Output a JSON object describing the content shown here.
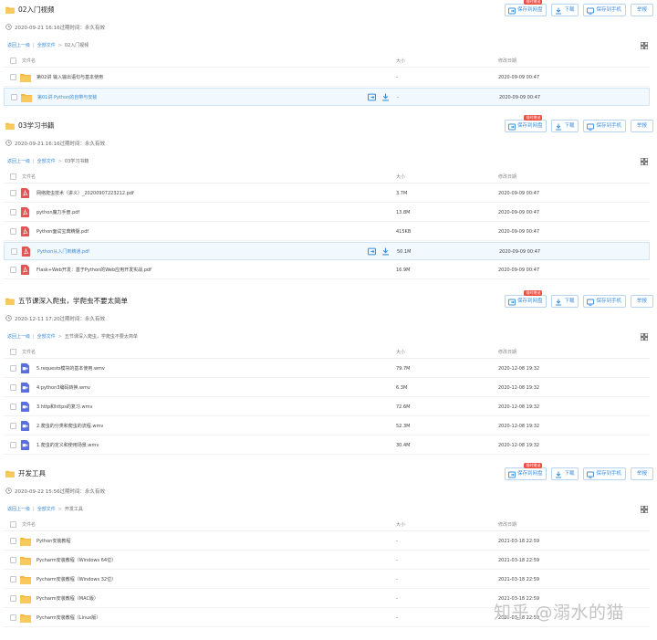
{
  "colors": {
    "accent": "#3b8cd9",
    "folder": "#f5b942",
    "pdf": "#e05555",
    "video": "#5b6ee1",
    "badge": "#e74c3c"
  },
  "icons": {
    "folder": "folder-icon",
    "pdf": "pdf-file-icon",
    "video": "video-file-icon",
    "clock": "clock-icon",
    "grid": "grid-view-icon",
    "save": "save-to-netdisk-icon",
    "download": "download-icon",
    "phone": "save-to-phone-icon"
  },
  "buttons": {
    "save_label": "保存到网盘",
    "download_label": "下载",
    "phone_label": "保存到手机",
    "report_label": "举报",
    "badge_label": "限时赠送"
  },
  "table_headers": {
    "name": "文件名",
    "size": "大小",
    "date": "修改日期"
  },
  "crumb": {
    "back": "返回上一级",
    "all": "全部文件"
  },
  "sections": [
    {
      "title": "02入门视频",
      "meta": "2020-09-21 16:16过期时间：永久有效",
      "crumb_current": "02入门视频",
      "rows": [
        {
          "name": "第02讲 输入输出语句与基本使用",
          "size": "-",
          "date": "2020-09-09 00:47",
          "type": "folder"
        },
        {
          "name": "第01讲 Python的自带与安装",
          "size": "-",
          "date": "2020-09-09 00:47",
          "type": "folder",
          "selected": true
        }
      ]
    },
    {
      "title": "03学习书籍",
      "meta": "2020-09-21 16:16过期时间：永久有效",
      "crumb_current": "03学习书籍",
      "rows": [
        {
          "name": "网络爬虫技术（讲义）_20200907223212.pdf",
          "size": "3.7M",
          "date": "2020-09-09 00:47",
          "type": "pdf"
        },
        {
          "name": "python魔力手册.pdf",
          "size": "13.8M",
          "date": "2020-09-09 00:47",
          "type": "pdf"
        },
        {
          "name": "Python面试宝典精髓.pdf",
          "size": "415KB",
          "date": "2020-09-09 00:47",
          "type": "pdf"
        },
        {
          "name": "Python从入门到精通.pdf",
          "size": "50.1M",
          "date": "2020-09-09 00:47",
          "type": "pdf",
          "selected": true
        },
        {
          "name": "Flask+Web开发：基于Python的Web应用开发实战.pdf",
          "size": "16.9M",
          "date": "2020-09-09 00:47",
          "type": "pdf"
        }
      ]
    },
    {
      "title": "五节课深入爬虫，学爬虫不要太简单",
      "meta": "2020-12-11 17:20过期时间：永久有效",
      "crumb_current": "五节课深入爬虫，学爬虫不要太简单",
      "rows": [
        {
          "name": "5.requests模块的基本使用.wmv",
          "size": "79.7M",
          "date": "2020-12-08 19:32",
          "type": "video"
        },
        {
          "name": "4.python3编码转换.wmv",
          "size": "6.3M",
          "date": "2020-12-08 19:32",
          "type": "video"
        },
        {
          "name": "3.http和https的复习.wmv",
          "size": "72.6M",
          "date": "2020-12-08 19:32",
          "type": "video"
        },
        {
          "name": "2.爬虫的分类和爬虫的流程.wmv",
          "size": "52.3M",
          "date": "2020-12-08 19:32",
          "type": "video"
        },
        {
          "name": "1.爬虫的定义和使用场景.wmv",
          "size": "30.4M",
          "date": "2020-12-08 19:32",
          "type": "video"
        }
      ]
    },
    {
      "title": "开发工具",
      "meta": "2020-09-22 15:56过期时间：永久有效",
      "crumb_current": "开发工具",
      "rows": [
        {
          "name": "Python安装教程",
          "size": "-",
          "date": "2021-03-18 22:59",
          "type": "folder"
        },
        {
          "name": "Pycharm安装教程（Windows 64位）",
          "size": "-",
          "date": "2021-03-18 22:59",
          "type": "folder"
        },
        {
          "name": "Pycharm安装教程（Windows 32位）",
          "size": "-",
          "date": "2021-03-18 22:59",
          "type": "folder"
        },
        {
          "name": "Pycharm安装教程（MAC版）",
          "size": "-",
          "date": "2021-03-18 22:59",
          "type": "folder"
        },
        {
          "name": "Pycharm安装教程（Linux版）",
          "size": "-",
          "date": "2021-03-18 22:59",
          "type": "folder"
        }
      ]
    }
  ],
  "watermark": "知乎 @溺水的猫"
}
